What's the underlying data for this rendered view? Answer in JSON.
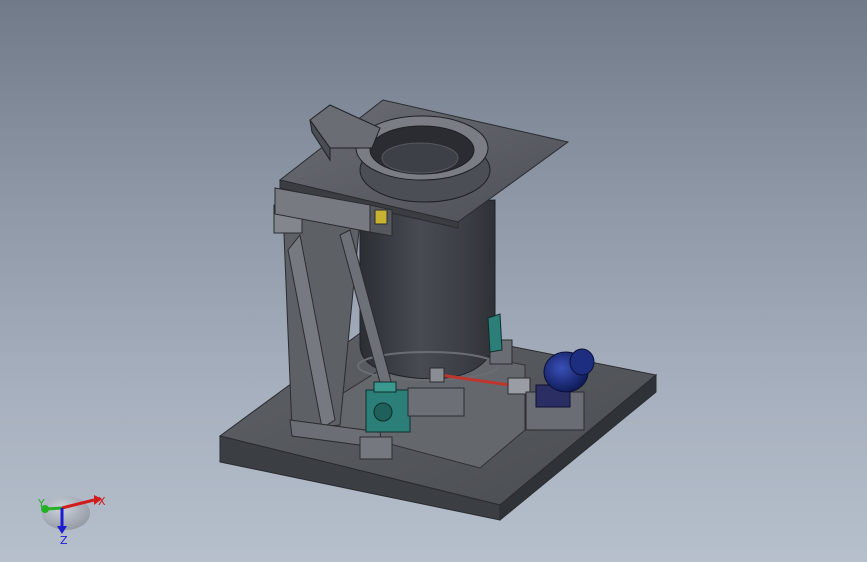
{
  "viewport": {
    "background_top": "#707a89",
    "background_bottom": "#b6bfcc"
  },
  "model": {
    "base_color": "#56595e",
    "hopper_color": "#3f4248",
    "frame_color": "#5b5e63",
    "gearbox_color": "#2b7f78",
    "motor_color": "#1b2f86",
    "shaft_color": "#c0362e"
  },
  "triad": {
    "x_label": "X",
    "y_label": "Y",
    "z_label": "Z",
    "x_color": "#d21b1b",
    "y_color": "#25b025",
    "z_color": "#1b1bd2"
  }
}
